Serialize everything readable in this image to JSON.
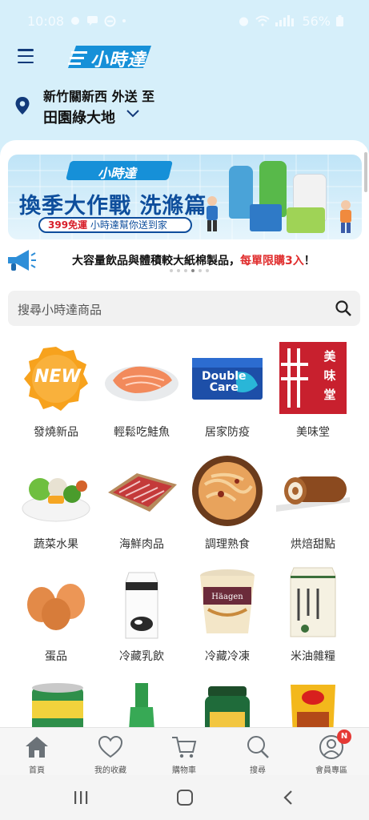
{
  "status_bar": {
    "time": "10:08",
    "battery": "56%"
  },
  "header": {
    "logo_text": "小時達"
  },
  "location": {
    "line1": "新竹關新西 外送 至",
    "line2": "田園綠大地"
  },
  "banner": {
    "logo_text": "小時達",
    "title": "換季大作戰 洗滌篇",
    "sub_red": "399免運",
    "sub_rest": "小時達幫你送到家"
  },
  "announcement": {
    "text": "大容量飲品與體積較大紙棉製品，",
    "red": "每單限購3入",
    "end": "！"
  },
  "search": {
    "placeholder": "搜尋小時達商品"
  },
  "categories": [
    {
      "label": "發燒新品",
      "icon": "new-badge-icon"
    },
    {
      "label": "輕鬆吃鮭魚",
      "icon": "salmon-icon"
    },
    {
      "label": "居家防疫",
      "icon": "mask-box-icon"
    },
    {
      "label": "美味堂",
      "icon": "meiweitang-logo"
    },
    {
      "label": "蔬菜水果",
      "icon": "vegetables-icon"
    },
    {
      "label": "海鮮肉品",
      "icon": "meat-icon"
    },
    {
      "label": "調理熟食",
      "icon": "noodles-icon"
    },
    {
      "label": "烘焙甜點",
      "icon": "cake-roll-icon"
    },
    {
      "label": "蛋品",
      "icon": "eggs-icon"
    },
    {
      "label": "冷藏乳飲",
      "icon": "milk-carton-icon"
    },
    {
      "label": "冷藏冷凍",
      "icon": "ice-cream-icon"
    },
    {
      "label": "米油雜糧",
      "icon": "rice-bag-icon"
    }
  ],
  "bottom_nav": [
    {
      "label": "首頁",
      "icon": "home-icon"
    },
    {
      "label": "我的收藏",
      "icon": "heart-icon"
    },
    {
      "label": "購物車",
      "icon": "cart-icon"
    },
    {
      "label": "搜尋",
      "icon": "search-icon"
    },
    {
      "label": "會員專區",
      "icon": "user-icon",
      "badge": "N"
    }
  ],
  "colors": {
    "accent": "#1690d8",
    "header_bg": "#d6effa",
    "brand_navy": "#123a7a",
    "alert_red": "#e02d2d"
  }
}
